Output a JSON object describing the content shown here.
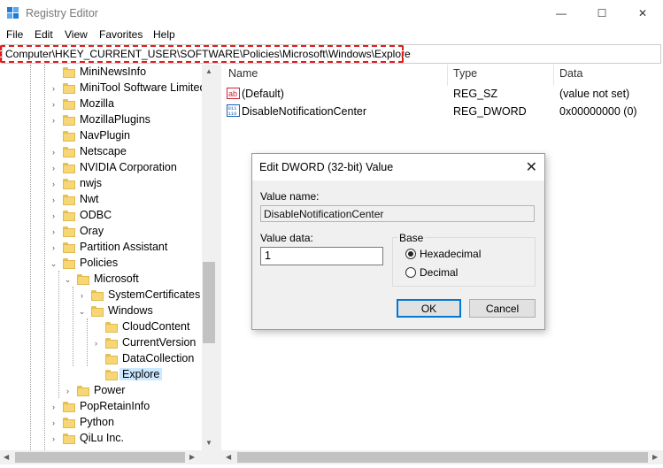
{
  "window": {
    "title": "Registry Editor",
    "minimize": "—",
    "maximize": "☐",
    "close": "✕"
  },
  "menu": [
    "File",
    "Edit",
    "View",
    "Favorites",
    "Help"
  ],
  "address": "Computer\\HKEY_CURRENT_USER\\SOFTWARE\\Policies\\Microsoft\\Windows\\Explore",
  "tree": [
    "MiniNewsInfo",
    "MiniTool Software Limited",
    "Mozilla",
    "MozillaPlugins",
    "NavPlugin",
    "Netscape",
    "NVIDIA Corporation",
    "nwjs",
    "Nwt",
    "ODBC",
    "Oray",
    "Partition Assistant",
    "Policies",
    "Microsoft",
    "SystemCertificates",
    "Windows",
    "CloudContent",
    "CurrentVersion",
    "DataCollection",
    "Explore",
    "Power",
    "PopRetainInfo",
    "Python",
    "QiLu Inc."
  ],
  "list": {
    "columns": [
      "Name",
      "Type",
      "Data"
    ],
    "rows": [
      {
        "name": "(Default)",
        "type": "REG_SZ",
        "data": "(value not set)",
        "icon": "ab-icon"
      },
      {
        "name": "DisableNotificationCenter",
        "type": "REG_DWORD",
        "data": "0x00000000 (0)",
        "icon": "binary-icon"
      }
    ]
  },
  "dialog": {
    "title": "Edit DWORD (32-bit) Value",
    "close": "✕",
    "value_name_label": "Value name:",
    "value_name": "DisableNotificationCenter",
    "value_data_label": "Value data:",
    "value_data": "1",
    "base_label": "Base",
    "hex_label": "Hexadecimal",
    "dec_label": "Decimal",
    "base_selected": "Hexadecimal",
    "ok": "OK",
    "cancel": "Cancel"
  },
  "colors": {
    "highlight_border": "#e21b1b",
    "selection": "#cce8ff",
    "default_button": "#0078d7"
  }
}
